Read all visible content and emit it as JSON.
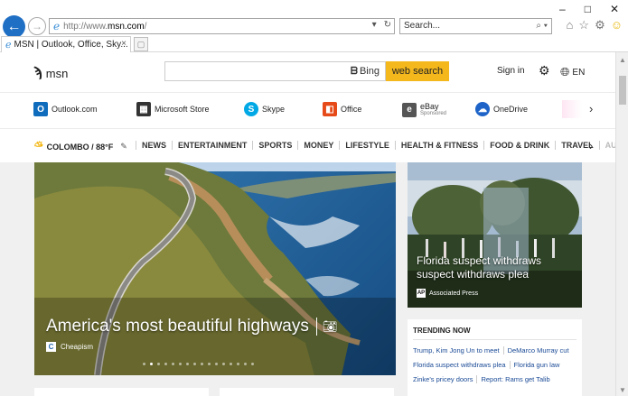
{
  "browser": {
    "address": {
      "url_prefix": "http://www.",
      "url_host": "msn.com",
      "url_suffix": "/",
      "dropdown_icon": "chevron-down-icon",
      "refresh_icon": "refresh-icon"
    },
    "search": {
      "placeholder": "Search...",
      "search_icon": "search-icon"
    },
    "tab": {
      "title": "MSN | Outlook, Office, Sky...",
      "close": "×"
    },
    "window_controls": [
      "–",
      "□",
      "✕"
    ]
  },
  "header": {
    "logo_text": "msn",
    "bing_label": "Bing",
    "search_button": "web search",
    "sign_in": "Sign in",
    "language": "EN"
  },
  "apps": [
    {
      "label": "Outlook.com",
      "sub": "",
      "icon": "outlook-icon",
      "color": "#0f6cbd"
    },
    {
      "label": "Microsoft Store",
      "sub": "",
      "icon": "store-icon",
      "color": "#333333"
    },
    {
      "label": "Skype",
      "sub": "",
      "icon": "skype-icon",
      "color": "#00a9e5"
    },
    {
      "label": "Office",
      "sub": "",
      "icon": "office-icon",
      "color": "#e64a19"
    },
    {
      "label": "eBay",
      "sub": "Sponsored",
      "icon": "ebay-icon",
      "color": "#555555"
    },
    {
      "label": "OneDrive",
      "sub": "",
      "icon": "onedrive-icon",
      "color": "#1e64c8"
    }
  ],
  "navbar": {
    "weather": "COLOMBO / 88°F",
    "links": [
      "NEWS",
      "ENTERTAINMENT",
      "SPORTS",
      "MONEY",
      "LIFESTYLE",
      "HEALTH & FITNESS",
      "FOOD & DRINK",
      "TRAVEL",
      "AUTO"
    ]
  },
  "hero": {
    "title": "America's most beautiful highways",
    "source": "Cheapism",
    "slide_count": 16,
    "active_slide": 2
  },
  "side_card": {
    "title_line1": "Florida suspect withdraws",
    "title_line2": "suspect withdraws plea",
    "source": "Associated Press"
  },
  "trending": {
    "heading": "TRENDING NOW",
    "rows": [
      [
        "Trump, Kim Jong Un to meet",
        "DeMarco Murray cut"
      ],
      [
        "Florida suspect withdraws plea",
        "Florida gun law"
      ],
      [
        "Zinke's pricey doors",
        "Report: Rams get Talib"
      ]
    ]
  },
  "colors": {
    "accent": "#f5b81c",
    "back_button": "#1f6fc5",
    "link": "#1a4a96"
  }
}
